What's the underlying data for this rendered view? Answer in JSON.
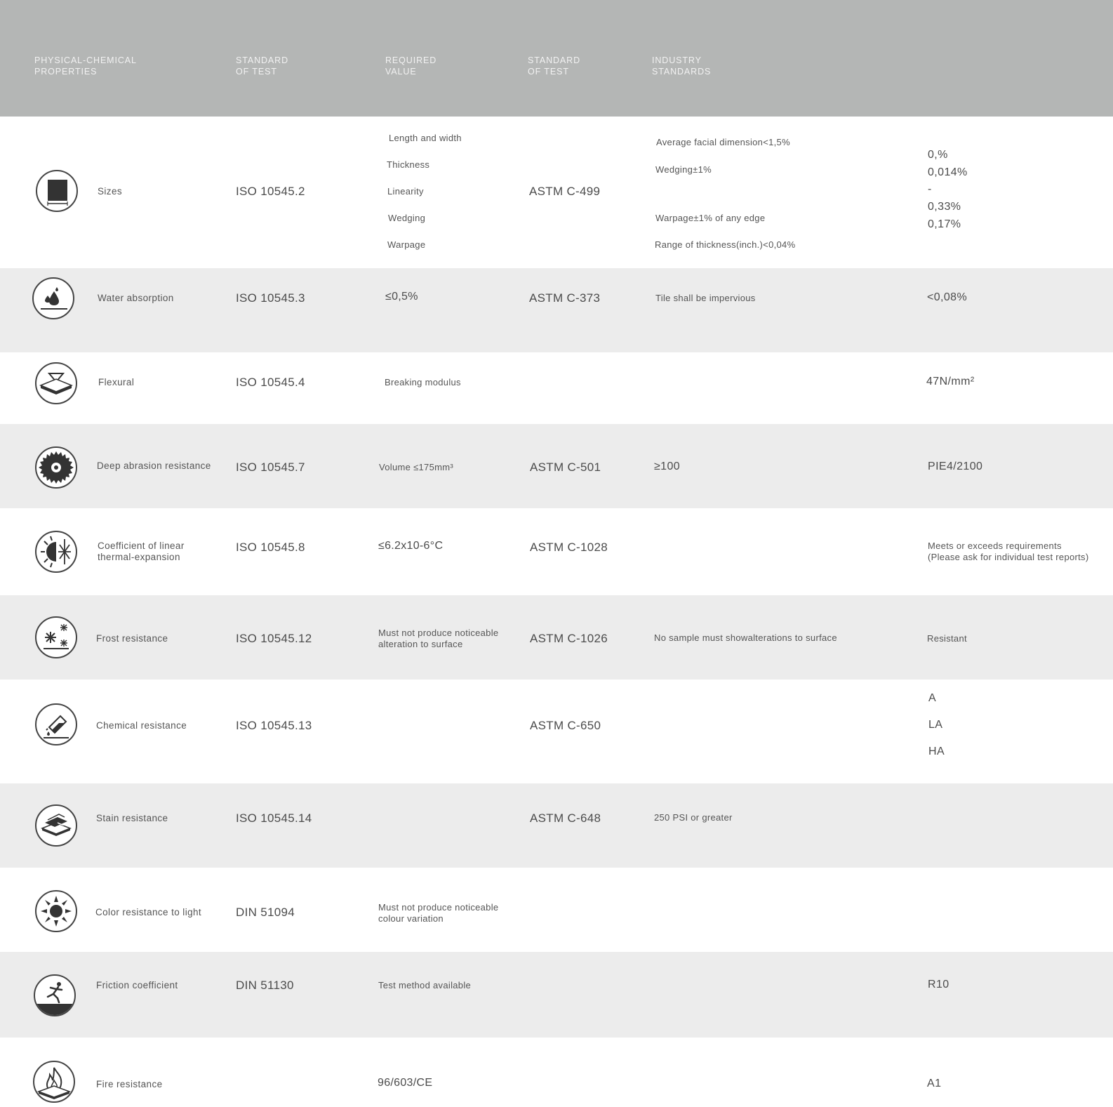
{
  "header": {
    "col1": "PHYSICAL-CHEMICAL\nPROPERTIES",
    "col2": "STANDARD\nOF TEST",
    "col3": "REQUIRED\nVALUE",
    "col4": "STANDARD\nOF TEST",
    "col5": "INDUSTRY\nSTANDARDS"
  },
  "rows": {
    "sizes": {
      "icon": "square-tile-icon",
      "label": "Sizes",
      "iso": "ISO 10545.2",
      "required": [
        "Length and width",
        "Thickness",
        "Linearity",
        "Wedging",
        "Warpage"
      ],
      "astm": "ASTM C-499",
      "industry": [
        "Average facial dimension<1,5%",
        "Wedging±1%",
        "Warpage±1% of any edge",
        "Range of thickness(inch.)<0,04%"
      ],
      "result": [
        "0,%",
        "0,014%",
        "-",
        "0,33%",
        "0,17%"
      ]
    },
    "water": {
      "icon": "water-drops-icon",
      "label": "Water  absorption",
      "iso": "ISO 10545.3",
      "required": "≤0,5%",
      "astm": "ASTM C-373",
      "industry": "Tile shall be impervious",
      "result": "<0,08%"
    },
    "flexural": {
      "icon": "flexural-tile-icon",
      "label": "Flexural",
      "iso": "ISO 10545.4",
      "required": "Breaking modulus",
      "result": "47N/mm²"
    },
    "abrasion": {
      "icon": "saw-blade-icon",
      "label": "Deep abrasion resistance",
      "iso": "ISO 10545.7",
      "required": "Volume  ≤175mm³",
      "astm": "ASTM C-501",
      "industry": "≥100",
      "result": "PIE4/2100"
    },
    "thermal": {
      "icon": "sun-snowflake-icon",
      "label": "Coefficient  of  linear\nthermal-expansion",
      "iso": "ISO 10545.8",
      "required": "≤6.2x10-6°C",
      "astm": "ASTM C-1028",
      "result": "Meets or exceeds requirements\n(Please ask for individual test reports)"
    },
    "frost": {
      "icon": "frost-icon",
      "label": "Frost  resistance",
      "iso": "ISO 10545.12",
      "required": "Must  not  produce  noticeable\nalteration  to  surface",
      "astm": "ASTM C-1026",
      "industry": "No sample must showalterations to surface",
      "result": "Resistant"
    },
    "chemical": {
      "icon": "chemical-flask-icon",
      "label": "Chemical resistance",
      "iso": "ISO 10545.13",
      "astm": "ASTM C-650",
      "result": [
        "A",
        "LA",
        "HA"
      ]
    },
    "stain": {
      "icon": "stain-tiles-icon",
      "label": "Stain  resistance",
      "iso": "ISO 10545.14",
      "astm": "ASTM C-648",
      "industry": "250  PSI  or  greater"
    },
    "color": {
      "icon": "sun-icon",
      "label": "Color resistance to light",
      "iso": "DIN 51094",
      "required": "Must not produce noticeable\ncolour variation"
    },
    "friction": {
      "icon": "slipping-person-icon",
      "label": "Friction  coefficient",
      "iso": "DIN 51130",
      "required": "Test  method  available",
      "result": "R10"
    },
    "fire": {
      "icon": "fire-icon",
      "label": "Fire resistance",
      "required": "96/603/CE",
      "result": "A1"
    }
  }
}
